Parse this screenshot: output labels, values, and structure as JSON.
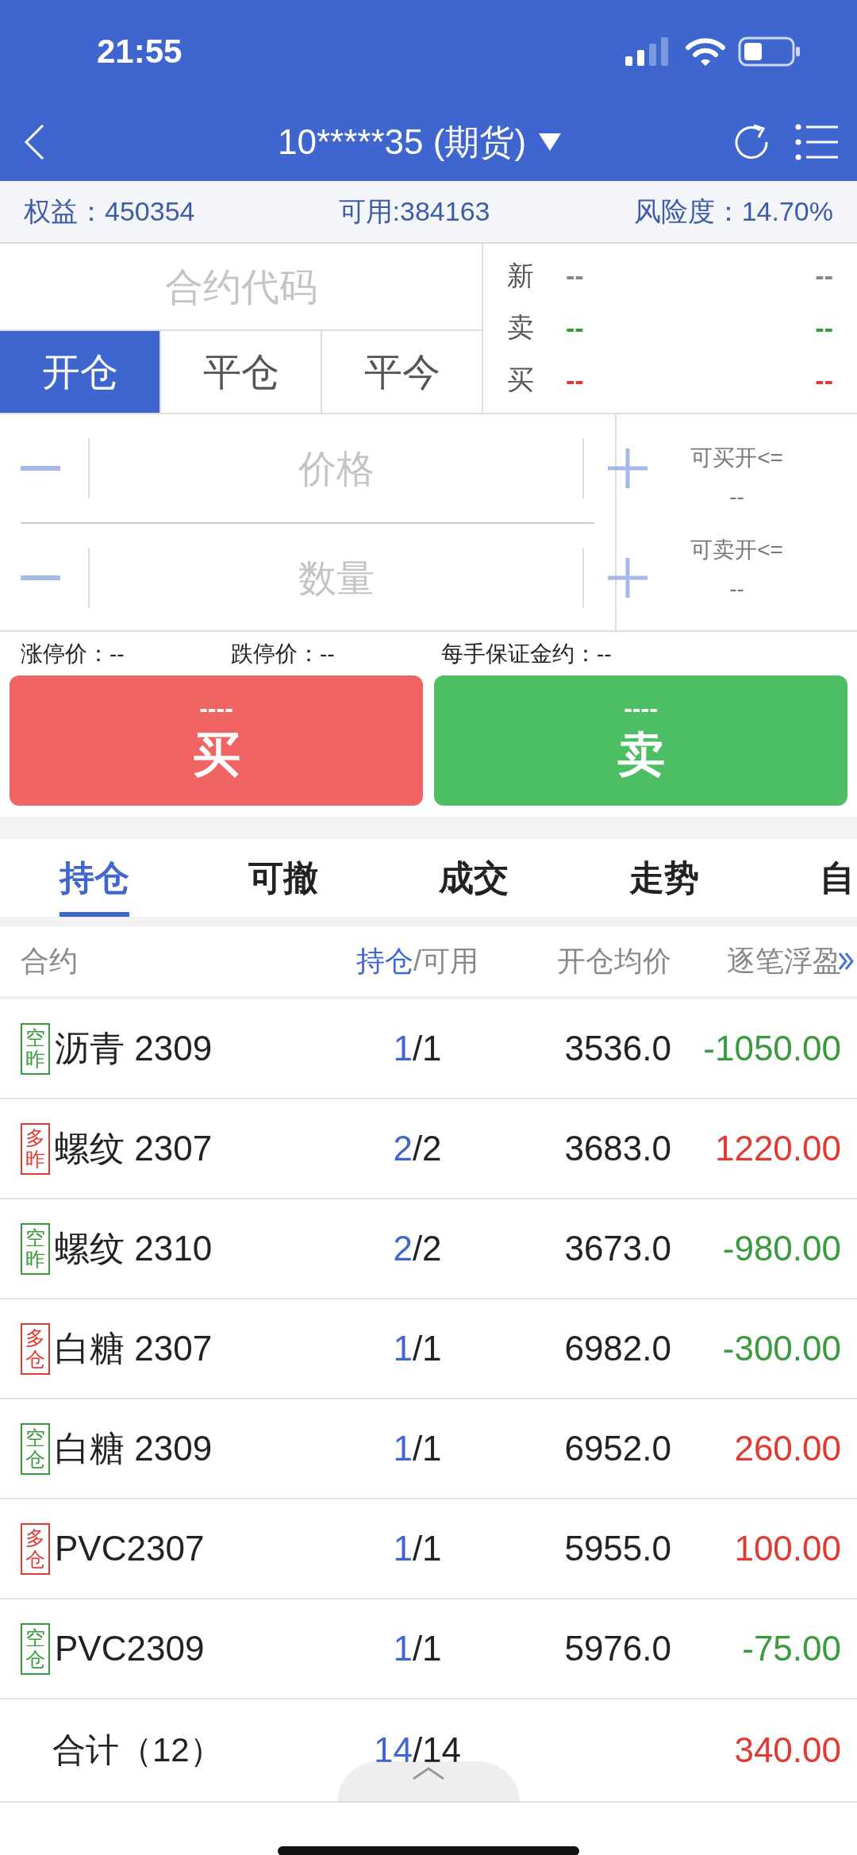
{
  "status_bar": {
    "time": "21:55"
  },
  "nav": {
    "title": "10*****35 (期货)"
  },
  "summary": [
    {
      "label": "权益：",
      "value": "450354"
    },
    {
      "label": "可用:",
      "value": "384163"
    },
    {
      "label": "风险度：",
      "value": "14.70%"
    }
  ],
  "contract_field": {
    "placeholder": "合约代码"
  },
  "order_tabs": [
    {
      "label": "开仓",
      "selected": true
    },
    {
      "label": "平仓",
      "selected": false
    },
    {
      "label": "平今",
      "selected": false
    }
  ],
  "quote": [
    {
      "label": "新",
      "left": "--",
      "right": "--",
      "color": "#888888"
    },
    {
      "label": "卖",
      "left": "--",
      "right": "--",
      "color": "#3a9a3e"
    },
    {
      "label": "买",
      "left": "--",
      "right": "--",
      "color": "#e03a32"
    }
  ],
  "inputs": [
    {
      "placeholder": "价格"
    },
    {
      "placeholder": "数量"
    }
  ],
  "capacity": [
    {
      "label": "可买开<=",
      "value": "--"
    },
    {
      "label": "可卖开<=",
      "value": "--"
    }
  ],
  "limits": [
    {
      "label": "涨停价：",
      "value": "--"
    },
    {
      "label": "跌停价：",
      "value": "--"
    },
    {
      "label": "每手保证金约：",
      "value": "--"
    }
  ],
  "actions": [
    {
      "kind": "buy",
      "price": "----",
      "label": "买"
    },
    {
      "kind": "sell",
      "price": "----",
      "label": "卖"
    }
  ],
  "tabs": [
    {
      "label": "持仓",
      "selected": true
    },
    {
      "label": "可撤",
      "selected": false
    },
    {
      "label": "成交",
      "selected": false
    },
    {
      "label": "走势",
      "selected": false
    },
    {
      "label": "自",
      "selected": false
    }
  ],
  "columns": [
    {
      "label": "合约"
    },
    {
      "label": "持仓",
      "sub": "/可用",
      "active": true
    },
    {
      "label": "开仓均价"
    },
    {
      "label": "逐笔浮盈"
    }
  ],
  "qty_separator": "/",
  "positions": [
    {
      "kind": "short",
      "tag": "空昨",
      "name": "沥青 2309",
      "held": "1",
      "available": "1",
      "avg_price": "3536.0",
      "pnl": "-1050.00",
      "color": "#3a9a3e"
    },
    {
      "kind": "long",
      "tag": "多昨",
      "name": "螺纹 2307",
      "held": "2",
      "available": "2",
      "avg_price": "3683.0",
      "pnl": "1220.00",
      "color": "#e03a32"
    },
    {
      "kind": "short",
      "tag": "空昨",
      "name": "螺纹 2310",
      "held": "2",
      "available": "2",
      "avg_price": "3673.0",
      "pnl": "-980.00",
      "color": "#3a9a3e"
    },
    {
      "kind": "long",
      "tag": "多仓",
      "name": "白糖 2307",
      "held": "1",
      "available": "1",
      "avg_price": "6982.0",
      "pnl": "-300.00",
      "color": "#3a9a3e"
    },
    {
      "kind": "short",
      "tag": "空仓",
      "name": "白糖 2309",
      "held": "1",
      "available": "1",
      "avg_price": "6952.0",
      "pnl": "260.00",
      "color": "#e03a32"
    },
    {
      "kind": "long",
      "tag": "多仓",
      "name": "PVC2307",
      "held": "1",
      "available": "1",
      "avg_price": "5955.0",
      "pnl": "100.00",
      "color": "#e03a32"
    },
    {
      "kind": "short",
      "tag": "空仓",
      "name": "PVC2309",
      "held": "1",
      "available": "1",
      "avg_price": "5976.0",
      "pnl": "-75.00",
      "color": "#3a9a3e"
    }
  ],
  "total": {
    "label": "合计（12）",
    "held": "14",
    "available": "14",
    "pnl": "340.00",
    "color": "#e03a32"
  }
}
